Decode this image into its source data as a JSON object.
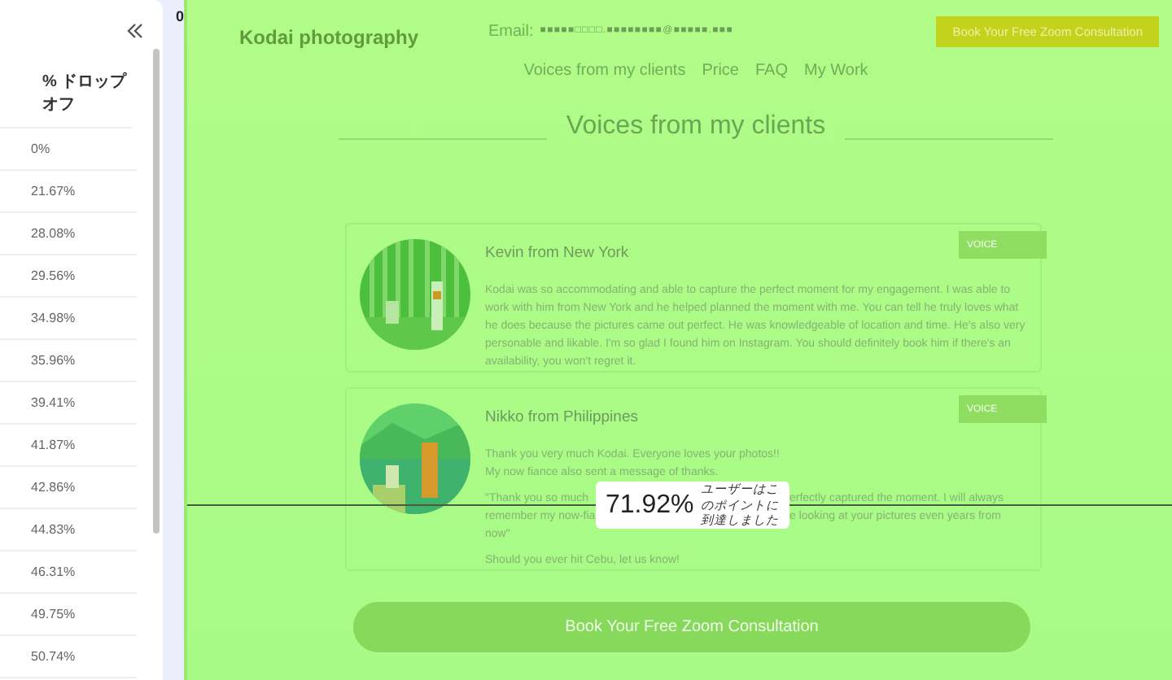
{
  "sidebar": {
    "heading": "% ドロップオフ",
    "rows": [
      "0%",
      "21.67%",
      "28.08%",
      "29.56%",
      "34.98%",
      "35.96%",
      "39.41%",
      "41.87%",
      "42.86%",
      "44.83%",
      "46.31%",
      "49.75%",
      "50.74%"
    ]
  },
  "ruler": {
    "label": "0"
  },
  "site": {
    "brand": "Kodai photography",
    "email_label": "Email:",
    "email_value": "■ ■ ■ ■ ■ □ □ □ □ . ■ ■ ■ ■ ■ ■ ■ ■ @ ■ ■ ■ ■ ■ . ■ ■ ■",
    "cta": "Book Your Free Zoom Consultation",
    "nav": [
      "Voices from my clients",
      "Price",
      "FAQ",
      "My Work"
    ],
    "section_title": "Voices from my clients",
    "testimonials": [
      {
        "name": "Kevin from New York",
        "badge": "VOICE",
        "paragraphs": [
          {
            "kind": "text",
            "text": "Kodai was so accommodating and able to capture the perfect moment for my engagement. I was able to work with him from New York and he helped planned the moment with me. You can tell he truly loves what he does because the pictures came out perfect. He was knowledgeable of location and time. He's also very personable and likable. I'm so glad I found him on Instagram. You should definitely book him if there's an availability, you won't regret it."
          }
        ]
      },
      {
        "name": "Nikko from Philippines",
        "badge": "VOICE",
        "paragraphs": [
          {
            "kind": "text",
            "text": "Thank you very much Kodai.  Everyone loves your photos!!\nMy now fiance also sent a message of thanks."
          },
          {
            "kind": "split",
            "lines": [
              [
                "\"Thank you so much",
                "erfectly captured the moment. I will always"
              ],
              [
                "remember my now-fia",
                "e looking at your pictures even years from"
              ],
              [
                "now\""
              ]
            ]
          },
          {
            "kind": "text",
            "text": "Should you ever hit Cebu, let us know!"
          }
        ]
      }
    ],
    "bottom_cta": "Book Your Free Zoom Consultation"
  },
  "marker": {
    "percent": "71.92%",
    "caption": "ユーザーはこのポイントに到達しました"
  }
}
